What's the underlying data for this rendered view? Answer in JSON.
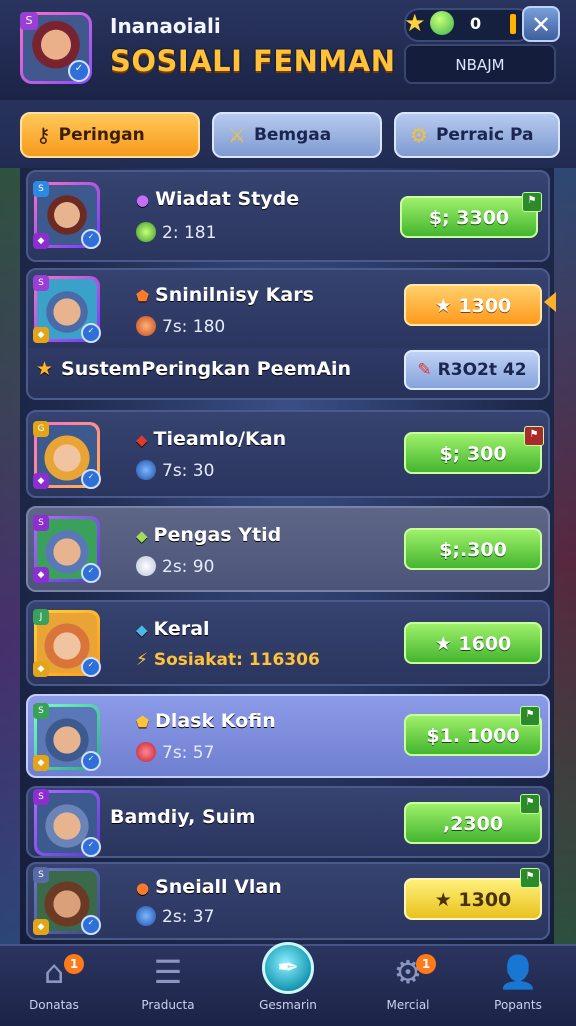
{
  "header": {
    "subtitle": "Inanaoiali",
    "title": "SOSIALI FENMAN",
    "currency_value": "0",
    "close_label": "✕",
    "name_box": "NBAJM"
  },
  "tabs": [
    {
      "label": "Peringan",
      "icon": "key-icon"
    },
    {
      "label": "Bemgaa",
      "icon": "swords-icon"
    },
    {
      "label": "Perraic Pa",
      "icon": "gear-icon"
    }
  ],
  "players": [
    {
      "name": "Wiadat Styde",
      "sub": "2: 181",
      "price": "$; 3300"
    },
    {
      "name": "Sninilnisy Kars",
      "sub": "7s: 180",
      "price": "1300"
    },
    {
      "name": "Tieamlo/Kan",
      "sub": "7s: 30",
      "price": "$; 300"
    },
    {
      "name": "Pengas Ytid",
      "sub": "2s: 90",
      "price": "$;.300"
    },
    {
      "name": "Keral",
      "sub": "Sosiakat: 116306",
      "price": "1600"
    },
    {
      "name": "Dlask Kofin",
      "sub": "7s: 57",
      "price": "$1. 1000"
    },
    {
      "name": "Bamdiy, Suim",
      "sub": "",
      "price": ",2300"
    },
    {
      "name": "Sneiall Vlan",
      "sub": "2s: 37",
      "price": "1300"
    }
  ],
  "system": {
    "label": "SustemPeringkan PeemAin",
    "button": "R3O2t 42"
  },
  "nav": [
    {
      "label": "Donatas",
      "icon": "home-icon",
      "badge": "1"
    },
    {
      "label": "Praducta",
      "icon": "notes-icon",
      "badge": ""
    },
    {
      "label": "Gesmarin",
      "icon": "feather-icon",
      "badge": ""
    },
    {
      "label": "Mercial",
      "icon": "gear-icon",
      "badge": "1"
    },
    {
      "label": "Popants",
      "icon": "person-icon",
      "badge": ""
    }
  ],
  "colors": {
    "accent_orange": "#f79a1c",
    "price_green": "#44b530",
    "title_gold": "#ffc23a"
  }
}
